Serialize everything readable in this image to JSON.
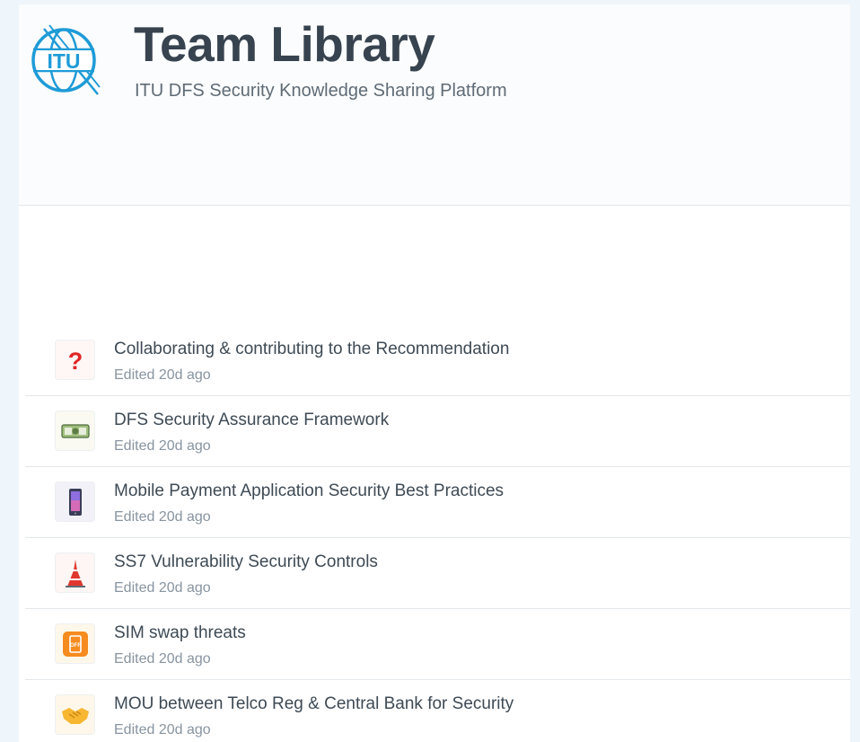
{
  "header": {
    "title": "Team Library",
    "subtitle": "ITU DFS Security Knowledge Sharing Platform",
    "logo": {
      "text": "ITU",
      "color": "#1e9bd7",
      "icon": "itu-logo-icon"
    }
  },
  "pages": [
    {
      "title": "Collaborating & contributing to the Recommendation",
      "meta": "Edited 20d ago",
      "icon": "question-mark-icon"
    },
    {
      "title": "DFS Security Assurance Framework",
      "meta": "Edited 20d ago",
      "icon": "dollar-banknote-icon"
    },
    {
      "title": "Mobile Payment Application Security Best Practices",
      "meta": "Edited 20d ago",
      "icon": "mobile-phone-icon"
    },
    {
      "title": "SS7 Vulnerability Security Controls",
      "meta": "Edited 20d ago",
      "icon": "tokyo-tower-icon"
    },
    {
      "title": "SIM swap threats",
      "meta": "Edited 20d ago",
      "icon": "mobile-off-icon"
    },
    {
      "title": "MOU between Telco Reg & Central Bank for Security",
      "meta": "Edited 20d ago",
      "icon": "handshake-icon"
    }
  ],
  "colors": {
    "background": "#eef6fb",
    "title": "#37434f",
    "meta": "#8894a0",
    "accent": "#1e9bd7"
  }
}
